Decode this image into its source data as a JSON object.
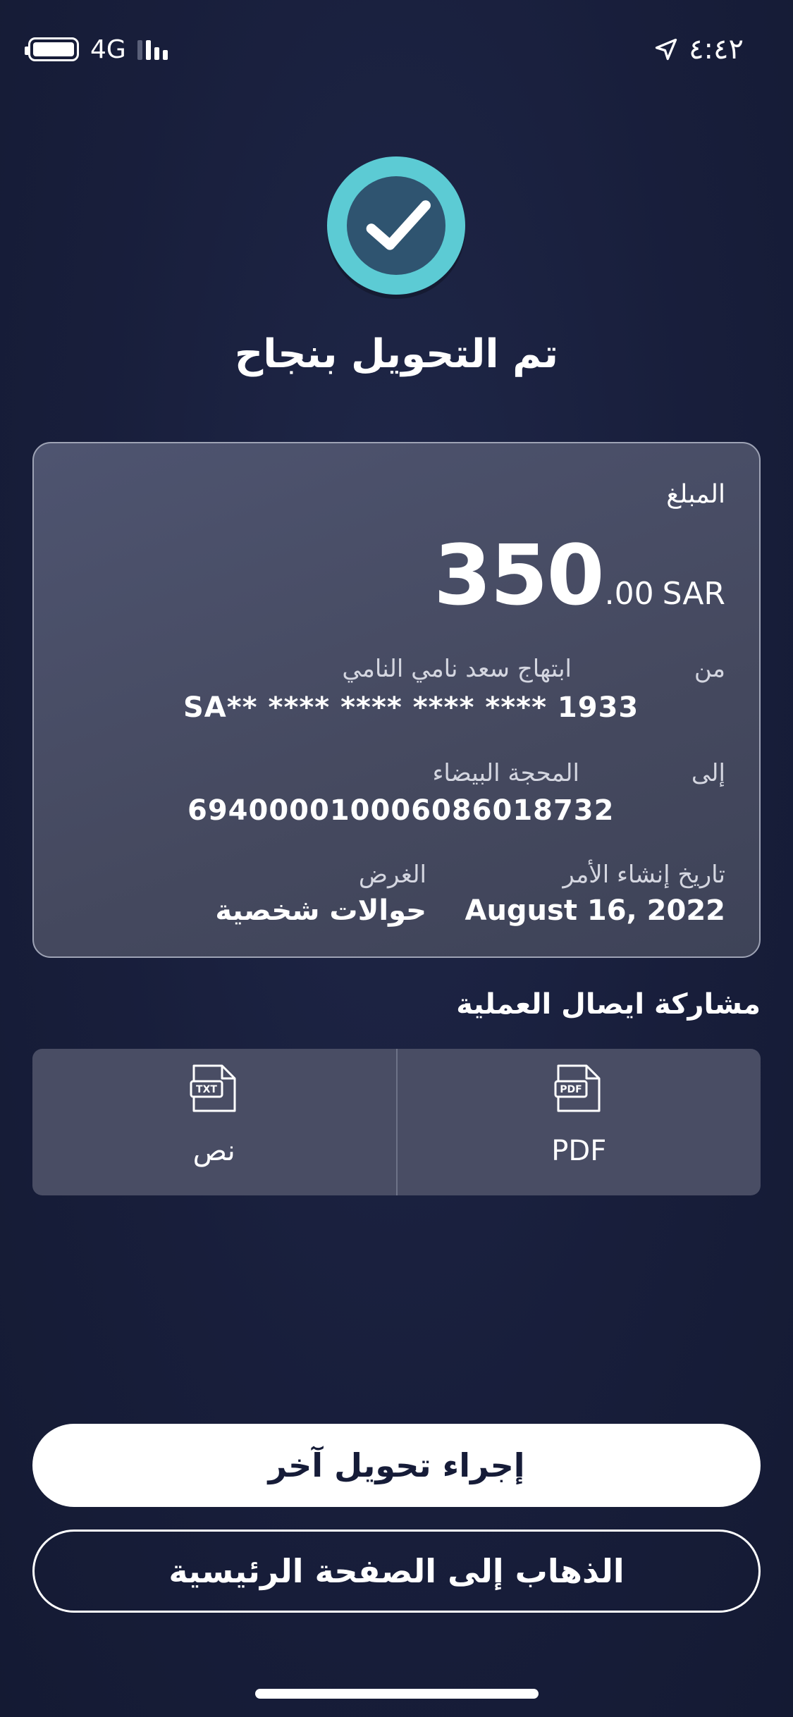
{
  "status_bar": {
    "network": "4G",
    "time": "٤:٤٢",
    "battery_level": 1.0,
    "signal_bars_active": 2,
    "signal_bars_total": 4
  },
  "title": "تم التحويل بنجاح",
  "card": {
    "amount_label": "المبلغ",
    "amount_integer": "350",
    "amount_decimal": ".00",
    "currency": "SAR",
    "from_label": "من",
    "from_name": "ابتهاج سعد نامي النامي",
    "from_account": "SA** **** **** **** **** 1933",
    "to_label": "إلى",
    "to_name": "المحجة البيضاء",
    "to_account": "6940000100060860187­32",
    "date_label": "تاريخ إنشاء الأمر",
    "date_value": "August 16, 2022",
    "purpose_label": "الغرض",
    "purpose_value": "حوالات شخصية"
  },
  "share": {
    "title": "مشاركة ايصال العملية",
    "pdf_label": "PDF",
    "pdf_icon_text": "PDF",
    "text_label": "نص",
    "text_icon_text": "TXT"
  },
  "buttons": {
    "another_transfer": "إجراء تحويل آخر",
    "go_home": "الذهاب إلى الصفحة الرئيسية"
  },
  "colors": {
    "background": "#161c38",
    "accent": "#5ccbd4",
    "card": "#4e5470"
  }
}
